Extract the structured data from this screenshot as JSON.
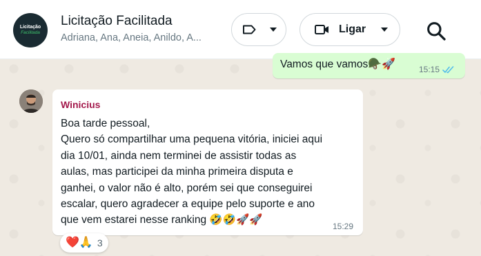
{
  "header": {
    "avatar_line1": "Licitação",
    "avatar_line2": "Facilitada",
    "title": "Licitação Facilitada",
    "members": "Adriana, Ana, Aneia, Anildo, A...",
    "call_label": "Ligar"
  },
  "outgoing": {
    "text": "Vamos que vamos",
    "emojis": "🪖🚀",
    "time": "15:15",
    "status": "read"
  },
  "incoming": {
    "sender": "Winicius",
    "lines": [
      "Boa tarde pessoal,",
      "Quero só compartilhar uma pequena vitória, iniciei aqui",
      "dia 10/01, ainda nem terminei de assistir todas as",
      "aulas, mas participei da minha primeira disputa e",
      "ganhei, o valor não é alto, porém sei que conseguirei",
      "escalar, quero agradecer a equipe pelo suporte e ano",
      "que vem estarei nesse ranking 🤣🤣🚀🚀"
    ],
    "time": "15:29",
    "reactions": {
      "emojis": "❤️🙏",
      "count": "3"
    }
  },
  "colors": {
    "background": "#efeae2",
    "outgoing_bubble": "#d9fdd3",
    "sender_name": "#a3184b",
    "read_ticks": "#53bdeb"
  },
  "icons": [
    "label-icon",
    "video-icon",
    "search-icon",
    "double-check-icon"
  ]
}
